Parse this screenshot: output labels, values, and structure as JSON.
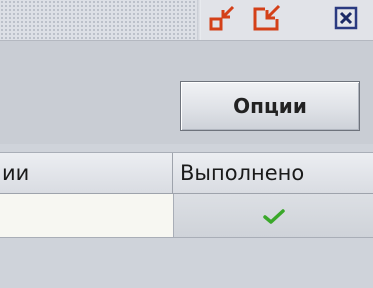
{
  "titlebar": {
    "controls": [
      {
        "icon": "minimize-icon"
      },
      {
        "icon": "restore-icon"
      },
      {
        "icon": "close-icon"
      }
    ]
  },
  "toolbar": {
    "options_label": "Опции"
  },
  "table": {
    "columns": [
      {
        "label": "ии"
      },
      {
        "label": "Выполнено"
      }
    ],
    "rows": [
      {
        "cells": [
          "",
          "checkmark-icon"
        ],
        "done": true
      }
    ]
  },
  "colors": {
    "accent": "#d44018",
    "close_border": "#2a3a80",
    "check": "#3aa82a"
  }
}
